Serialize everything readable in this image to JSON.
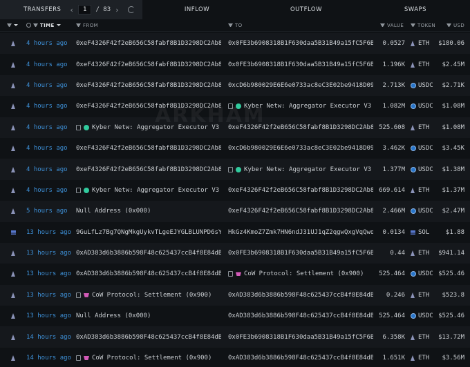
{
  "topbar": {
    "transfers_label": "TRANSFERS",
    "page_current": "1",
    "page_total": "/ 83",
    "tabs": [
      "INFLOW",
      "OUTFLOW",
      "SWAPS"
    ]
  },
  "columns": {
    "time": "TIME",
    "from": "FROM",
    "to": "TO",
    "value": "VALUE",
    "token": "TOKEN",
    "usd": "USD"
  },
  "watermark": "ARKHAM",
  "rows": [
    {
      "chain": "eth",
      "time": "4 hours ago",
      "from": "0xeF4326F42f2eB656C58fabf8B1D3298DC2Ab8...",
      "from_type": "addr",
      "to": "0x0FE3b6908318B1F630daa5B31B49a15fC5F6B...",
      "to_type": "addr",
      "value": "0.0527",
      "token": "ETH",
      "token_icon": "eth",
      "usd": "$180.06"
    },
    {
      "chain": "eth",
      "time": "4 hours ago",
      "from": "0xeF4326F42f2eB656C58fabf8B1D3298DC2Ab8...",
      "from_type": "addr",
      "to": "0x0FE3b6908318B1F630daa5B31B49a15fC5F6B...",
      "to_type": "addr",
      "value": "1.196K",
      "token": "ETH",
      "token_icon": "eth",
      "usd": "$2.45M"
    },
    {
      "chain": "eth",
      "time": "4 hours ago",
      "from": "0xeF4326F42f2eB656C58fabf8B1D3298DC2Ab8...",
      "from_type": "addr",
      "to": "0xcD6b980029E6E6e0733ac8eC3E02be9418D09...",
      "to_type": "addr",
      "value": "2.713K",
      "token": "USDC",
      "token_icon": "usdc",
      "usd": "$2.71K"
    },
    {
      "chain": "eth",
      "time": "4 hours ago",
      "from": "0xeF4326F42f2eB656C58fabf8B1D3298DC2Ab8...",
      "from_type": "addr",
      "to": "Kyber Netw: Aggregator Executor V3",
      "to_type": "kyber",
      "value": "1.082M",
      "token": "USDC",
      "token_icon": "usdc",
      "usd": "$1.08M"
    },
    {
      "chain": "eth",
      "time": "4 hours ago",
      "from": "Kyber Netw: Aggregator Executor V3",
      "from_type": "kyber",
      "to": "0xeF4326F42f2eB656C58fabf8B1D3298DC2Ab8...",
      "to_type": "addr",
      "value": "525.608",
      "token": "ETH",
      "token_icon": "eth",
      "usd": "$1.08M"
    },
    {
      "chain": "eth",
      "time": "4 hours ago",
      "from": "0xeF4326F42f2eB656C58fabf8B1D3298DC2Ab8...",
      "from_type": "addr",
      "to": "0xcD6b980029E6E6e0733ac8eC3E02be9418D09...",
      "to_type": "addr",
      "value": "3.462K",
      "token": "USDC",
      "token_icon": "usdc",
      "usd": "$3.45K"
    },
    {
      "chain": "eth",
      "time": "4 hours ago",
      "from": "0xeF4326F42f2eB656C58fabf8B1D3298DC2Ab8...",
      "from_type": "addr",
      "to": "Kyber Netw: Aggregator Executor V3",
      "to_type": "kyber",
      "value": "1.377M",
      "token": "USDC",
      "token_icon": "usdc",
      "usd": "$1.38M"
    },
    {
      "chain": "eth",
      "time": "4 hours ago",
      "from": "Kyber Netw: Aggregator Executor V3",
      "from_type": "kyber",
      "to": "0xeF4326F42f2eB656C58fabf8B1D3298DC2Ab8...",
      "to_type": "addr",
      "value": "669.614",
      "token": "ETH",
      "token_icon": "eth",
      "usd": "$1.37M"
    },
    {
      "chain": "eth",
      "time": "5 hours ago",
      "from": "Null Address (0x000)",
      "from_type": "addr",
      "to": "0xeF4326F42f2eB656C58fabf8B1D3298DC2Ab8...",
      "to_type": "addr",
      "value": "2.466M",
      "token": "USDC",
      "token_icon": "usdc",
      "usd": "$2.47M"
    },
    {
      "chain": "sol",
      "time": "13 hours ago",
      "from": "9GuLfLz7Bg7QNgMkgUykvTLgeEJYGLBLUNPD6sY...",
      "from_type": "addr",
      "to": "HkGz4KmoZ7Zmk7HN6ndJ31UJ1qZ2qgwQxgVqQwo...",
      "to_type": "addr",
      "value": "0.0134",
      "token": "SOL",
      "token_icon": "sol",
      "usd": "$1.88"
    },
    {
      "chain": "eth",
      "time": "13 hours ago",
      "from": "0xAD383d6b3886b598F48c625437ccB4f8E84dB...",
      "from_type": "addr",
      "to": "0x0FE3b6908318B1F630daa5B31B49a15fC5F6B...",
      "to_type": "addr",
      "value": "0.44",
      "token": "ETH",
      "token_icon": "eth",
      "usd": "$941.14"
    },
    {
      "chain": "eth",
      "time": "13 hours ago",
      "from": "0xAD383d6b3886b598F48c625437ccB4f8E84dB...",
      "from_type": "addr",
      "to": "CoW Protocol: Settlement (0x900)",
      "to_type": "cow",
      "value": "525.464",
      "token": "USDC",
      "token_icon": "usdc",
      "usd": "$525.46"
    },
    {
      "chain": "eth",
      "time": "13 hours ago",
      "from": "CoW Protocol: Settlement (0x900)",
      "from_type": "cow",
      "to": "0xAD383d6b3886b598F48c625437ccB4f8E84dB...",
      "to_type": "addr",
      "value": "0.246",
      "token": "ETH",
      "token_icon": "eth",
      "usd": "$523.8"
    },
    {
      "chain": "eth",
      "time": "13 hours ago",
      "from": "Null Address (0x000)",
      "from_type": "addr",
      "to": "0xAD383d6b3886b598F48c625437ccB4f8E84dB...",
      "to_type": "addr",
      "value": "525.464",
      "token": "USDC",
      "token_icon": "usdc",
      "usd": "$525.46"
    },
    {
      "chain": "eth",
      "time": "14 hours ago",
      "from": "0xAD383d6b3886b598F48c625437ccB4f8E84dB...",
      "from_type": "addr",
      "to": "0x0FE3b6908318B1F630daa5B31B49a15fC5F6B...",
      "to_type": "addr",
      "value": "6.358K",
      "token": "ETH",
      "token_icon": "eth",
      "usd": "$13.72M"
    },
    {
      "chain": "eth",
      "time": "14 hours ago",
      "from": "CoW Protocol: Settlement (0x900)",
      "from_type": "cow",
      "to": "0xAD383d6b3886b598F48c625437ccB4f8E84dB...",
      "to_type": "addr",
      "value": "1.651K",
      "token": "ETH",
      "token_icon": "eth",
      "usd": "$3.56M"
    }
  ]
}
